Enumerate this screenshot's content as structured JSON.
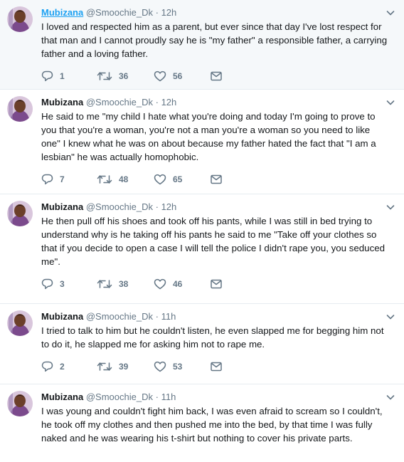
{
  "colors": {
    "accent": "#1da1f2",
    "muted": "#657786",
    "text": "#14171a",
    "divider": "#e6ecf0",
    "highlight_bg": "#f5f8fa"
  },
  "icons": {
    "reply": "reply-icon",
    "retweet": "retweet-icon",
    "like": "heart-icon",
    "dm": "envelope-icon",
    "more": "chevron-down-icon"
  },
  "tweets": [
    {
      "name": "Mubizana",
      "handle": "@Smoochie_Dk",
      "time": "12h",
      "text": "I loved and respected him as a parent, but ever since that day I've lost respect for that man and I cannot proudly say he is \"my father\" a responsible father, a carrying father and a loving father.",
      "replies": "1",
      "retweets": "36",
      "likes": "56"
    },
    {
      "name": "Mubizana",
      "handle": "@Smoochie_Dk",
      "time": "12h",
      "text": "He said to me \"my child I hate what you're doing and today I'm going to prove to you that you're a woman, you're not a man you're a woman so you need to like one\" I knew what he was on about because my father hated the fact that \"I am a lesbian\" he was actually homophobic.",
      "replies": "7",
      "retweets": "48",
      "likes": "65"
    },
    {
      "name": "Mubizana",
      "handle": "@Smoochie_Dk",
      "time": "12h",
      "text": "He then pull off his shoes and took off his pants, while I was still in bed trying to understand why is he taking off his pants he said to me \"Take off your clothes so that if you decide to open a case I will tell the police I didn't rape you, you seduced me\".",
      "replies": "3",
      "retweets": "38",
      "likes": "46"
    },
    {
      "name": "Mubizana",
      "handle": "@Smoochie_Dk",
      "time": "11h",
      "text": "I tried to talk to him but he couldn't listen, he even slapped me for begging him not to do it, he slapped me for asking him not to rape me.",
      "replies": "2",
      "retweets": "39",
      "likes": "53"
    },
    {
      "name": "Mubizana",
      "handle": "@Smoochie_Dk",
      "time": "11h",
      "text": "I was young and couldn't fight him back, I was even afraid to scream so I couldn't, he took off my clothes and then pushed me into the bed, by that time I was fully naked and he was wearing his t-shirt but nothing to cover his private parts."
    }
  ]
}
